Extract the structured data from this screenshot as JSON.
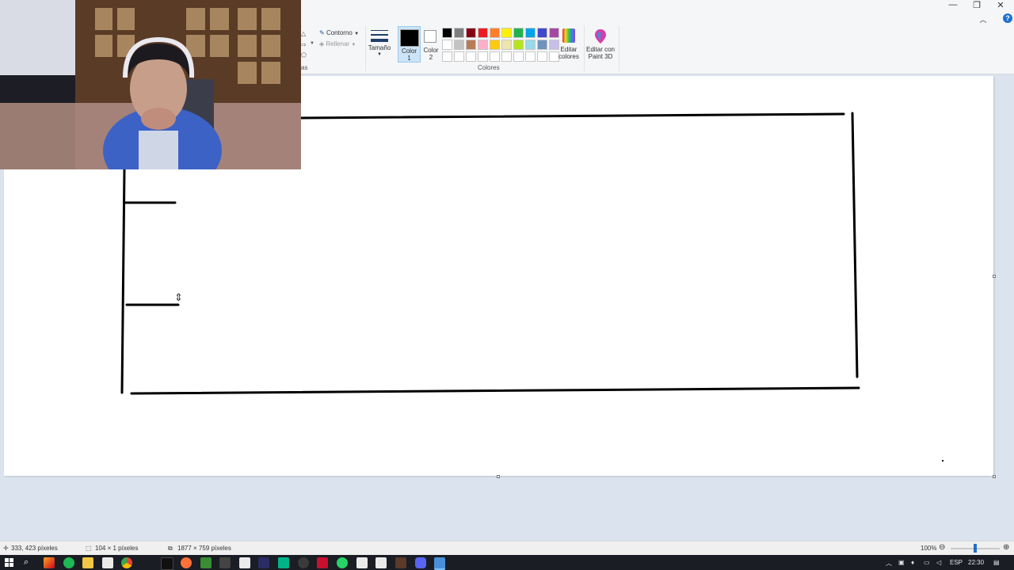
{
  "window": {
    "minimize": "—",
    "restore": "❐",
    "close": "✕",
    "help": "?"
  },
  "ribbon": {
    "shapes_group_fragment": "as",
    "outline_label": "Contorno",
    "fill_label": "Rellenar",
    "size_label": "Tamaño",
    "color1_label_line1": "Color",
    "color1_label_line2": "1",
    "color2_label_line1": "Color",
    "color2_label_line2": "2",
    "edit_colors_line1": "Editar",
    "edit_colors_line2": "colores",
    "paint3d_line1": "Editar con",
    "paint3d_line2": "Paint 3D",
    "colors_group_label": "Colores",
    "color1_value": "#000000",
    "color2_value": "#ffffff",
    "palette_row1": [
      "#000000",
      "#7f7f7f",
      "#880015",
      "#ed1c24",
      "#ff7f27",
      "#fff200",
      "#22b14c",
      "#00a2e8",
      "#3f48cc",
      "#a349a4"
    ],
    "palette_row2": [
      "#ffffff",
      "#c3c3c3",
      "#b97a57",
      "#ffaec9",
      "#ffc90e",
      "#efe4b0",
      "#b5e61d",
      "#99d9ea",
      "#7092be",
      "#c8bfe7"
    ],
    "palette_row3": [
      "#ffffff",
      "#ffffff",
      "#ffffff",
      "#ffffff",
      "#ffffff",
      "#ffffff",
      "#ffffff",
      "#ffffff",
      "#ffffff",
      "#ffffff"
    ]
  },
  "statusbar": {
    "cursor_position": "333, 423 píxeles",
    "selection_size": "104 × 1 píxeles",
    "image_size": "1877 × 759 píxeles",
    "zoom": "100%",
    "zoom_level": 0.5
  },
  "taskbar": {
    "language": "ESP",
    "time": "22:30"
  }
}
